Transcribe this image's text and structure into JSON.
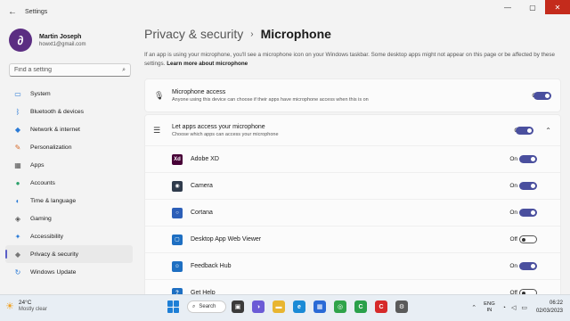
{
  "window": {
    "title": "Settings",
    "controls": {
      "minimize": "—",
      "maximize": "▢",
      "close": "✕"
    }
  },
  "profile": {
    "initial": "∂",
    "name": "Martin Joseph",
    "email": "howxt1@gmail.com"
  },
  "search": {
    "placeholder": "Find a setting"
  },
  "nav": {
    "items": [
      {
        "label": "System",
        "icon": "monitor-icon",
        "color": "#2a7ad6"
      },
      {
        "label": "Bluetooth & devices",
        "icon": "bluetooth-icon",
        "color": "#2a7ad6"
      },
      {
        "label": "Network & internet",
        "icon": "wifi-icon",
        "color": "#2a7ad6"
      },
      {
        "label": "Personalization",
        "icon": "brush-icon",
        "color": "#d66a2a"
      },
      {
        "label": "Apps",
        "icon": "apps-icon",
        "color": "#555555"
      },
      {
        "label": "Accounts",
        "icon": "person-icon",
        "color": "#2aa06a"
      },
      {
        "label": "Time & language",
        "icon": "globe-icon",
        "color": "#2a7ad6"
      },
      {
        "label": "Gaming",
        "icon": "gamepad-icon",
        "color": "#555555"
      },
      {
        "label": "Accessibility",
        "icon": "accessibility-icon",
        "color": "#2a7ad6"
      },
      {
        "label": "Privacy & security",
        "icon": "shield-icon",
        "color": "#777777",
        "active": true
      },
      {
        "label": "Windows Update",
        "icon": "update-icon",
        "color": "#2a7ad6"
      }
    ]
  },
  "breadcrumb": {
    "parent": "Privacy & security",
    "separator": "›",
    "current": "Microphone"
  },
  "description": {
    "text": "If an app is using your microphone, you'll see a microphone icon on your Windows taskbar. Some desktop apps might not appear on this page or be affected by these settings.",
    "link": "Learn more about microphone"
  },
  "mic_access": {
    "title": "Microphone access",
    "subtitle": "Anyone using this device can choose if their apps have microphone access when this is on",
    "state": "On",
    "on": true
  },
  "apps_access": {
    "title": "Let apps access your microphone",
    "subtitle": "Choose which apps can access your microphone",
    "state": "On",
    "on": true
  },
  "apps": [
    {
      "name": "Adobe XD",
      "state": "On",
      "on": true,
      "icon_text": "Xd",
      "color": "#470137"
    },
    {
      "name": "Camera",
      "state": "On",
      "on": true,
      "icon_text": "◉",
      "color": "#2f3b4c"
    },
    {
      "name": "Cortana",
      "state": "On",
      "on": true,
      "icon_text": "○",
      "color": "#2c5fb8"
    },
    {
      "name": "Desktop App Web Viewer",
      "state": "Off",
      "on": false,
      "icon_text": "▢",
      "color": "#1e6fc2"
    },
    {
      "name": "Feedback Hub",
      "state": "On",
      "on": true,
      "icon_text": "☺",
      "color": "#1e6fc2"
    },
    {
      "name": "Get Help",
      "state": "Off",
      "on": false,
      "icon_text": "?",
      "color": "#1e6fc2"
    }
  ],
  "taskbar": {
    "weather": {
      "temp": "24°C",
      "desc": "Mostly clear"
    },
    "search_label": "Search",
    "apps": [
      {
        "name": "task-view",
        "text": "▣",
        "color": "#3a3a3a"
      },
      {
        "name": "chat",
        "text": "◑",
        "color": "#6b5bd6"
      },
      {
        "name": "file-explorer",
        "text": "▬",
        "color": "#e8b530"
      },
      {
        "name": "edge",
        "text": "e",
        "color": "#1a8ad6"
      },
      {
        "name": "store",
        "text": "▦",
        "color": "#2a6ad6"
      },
      {
        "name": "chrome",
        "text": "◎",
        "color": "#2fa34a"
      },
      {
        "name": "camtasia",
        "text": "C",
        "color": "#2aa04a"
      },
      {
        "name": "recorder",
        "text": "C",
        "color": "#d62a2a"
      },
      {
        "name": "settings",
        "text": "⚙",
        "color": "#5a5a5a"
      }
    ],
    "lang": {
      "line1": "ENG",
      "line2": "IN"
    },
    "time": "06:22",
    "date": "02/03/2023"
  }
}
